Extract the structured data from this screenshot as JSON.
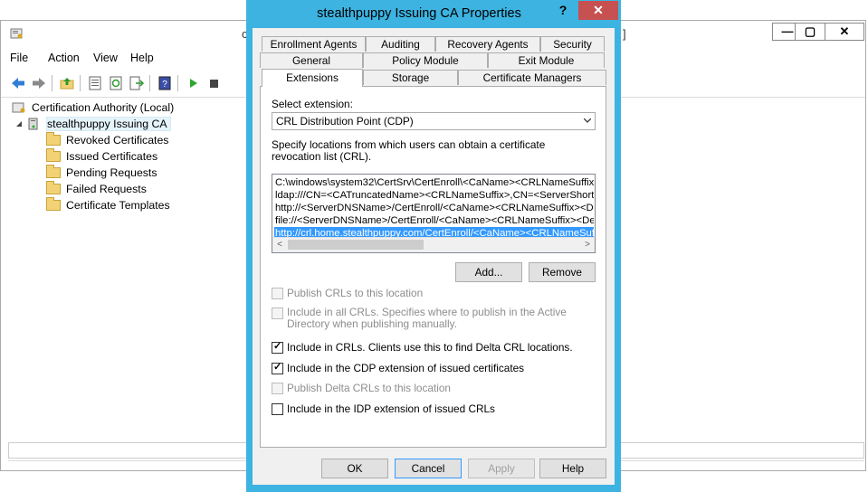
{
  "mmc": {
    "title_peek_left": "c",
    "title_peek_right": "]",
    "menu": [
      "File",
      "Action",
      "View",
      "Help"
    ],
    "window_controls": {
      "minimize": "—",
      "maximize": "▢",
      "close": "✕"
    },
    "tree": {
      "root": "Certification Authority (Local)",
      "ca": "stealthpuppy Issuing CA",
      "folders": [
        "Revoked Certificates",
        "Issued Certificates",
        "Pending Requests",
        "Failed Requests",
        "Certificate Templates"
      ]
    }
  },
  "dialog": {
    "title": "stealthpuppy Issuing CA Properties",
    "help_glyph": "?",
    "close_glyph": "✕",
    "tabs_row1": [
      "Enrollment Agents",
      "Auditing",
      "Recovery Agents",
      "Security"
    ],
    "tabs_row2": [
      "General",
      "Policy Module",
      "Exit Module"
    ],
    "tabs_row3": [
      "Extensions",
      "Storage",
      "Certificate Managers"
    ],
    "active_tab": "Extensions",
    "select_extension_label": "Select extension:",
    "select_extension_value": "CRL Distribution Point (CDP)",
    "locations_description": "Specify locations from which users can obtain a certificate revocation list (CRL).",
    "locations": [
      "C:\\windows\\system32\\CertSrv\\CertEnroll\\<CaName><CRLNameSuffix><",
      "ldap:///CN=<CATruncatedName><CRLNameSuffix>,CN=<ServerShortN",
      "http://<ServerDNSName>/CertEnroll/<CaName><CRLNameSuffix><Del",
      "file://<ServerDNSName>/CertEnroll/<CaName><CRLNameSuffix><Delta",
      "http://crl.home.stealthpuppy.com/CertEnroll/<CaName><CRLNameSuffi"
    ],
    "selected_location_index": 4,
    "add_button": "Add...",
    "remove_button": "Remove",
    "checkboxes": [
      {
        "label": "Publish CRLs to this location",
        "checked": false,
        "enabled": false
      },
      {
        "label": "Include in all CRLs. Specifies where to publish in the Active Directory when publishing manually.",
        "checked": false,
        "enabled": false
      },
      {
        "label": "Include in CRLs. Clients use this to find Delta CRL locations.",
        "checked": true,
        "enabled": true
      },
      {
        "label": "Include in the CDP extension of issued certificates",
        "checked": true,
        "enabled": true
      },
      {
        "label": "Publish Delta CRLs to this location",
        "checked": false,
        "enabled": false
      },
      {
        "label": "Include in the IDP extension of issued CRLs",
        "checked": false,
        "enabled": true
      }
    ],
    "buttons": {
      "ok": "OK",
      "cancel": "Cancel",
      "apply": "Apply",
      "help": "Help"
    }
  }
}
